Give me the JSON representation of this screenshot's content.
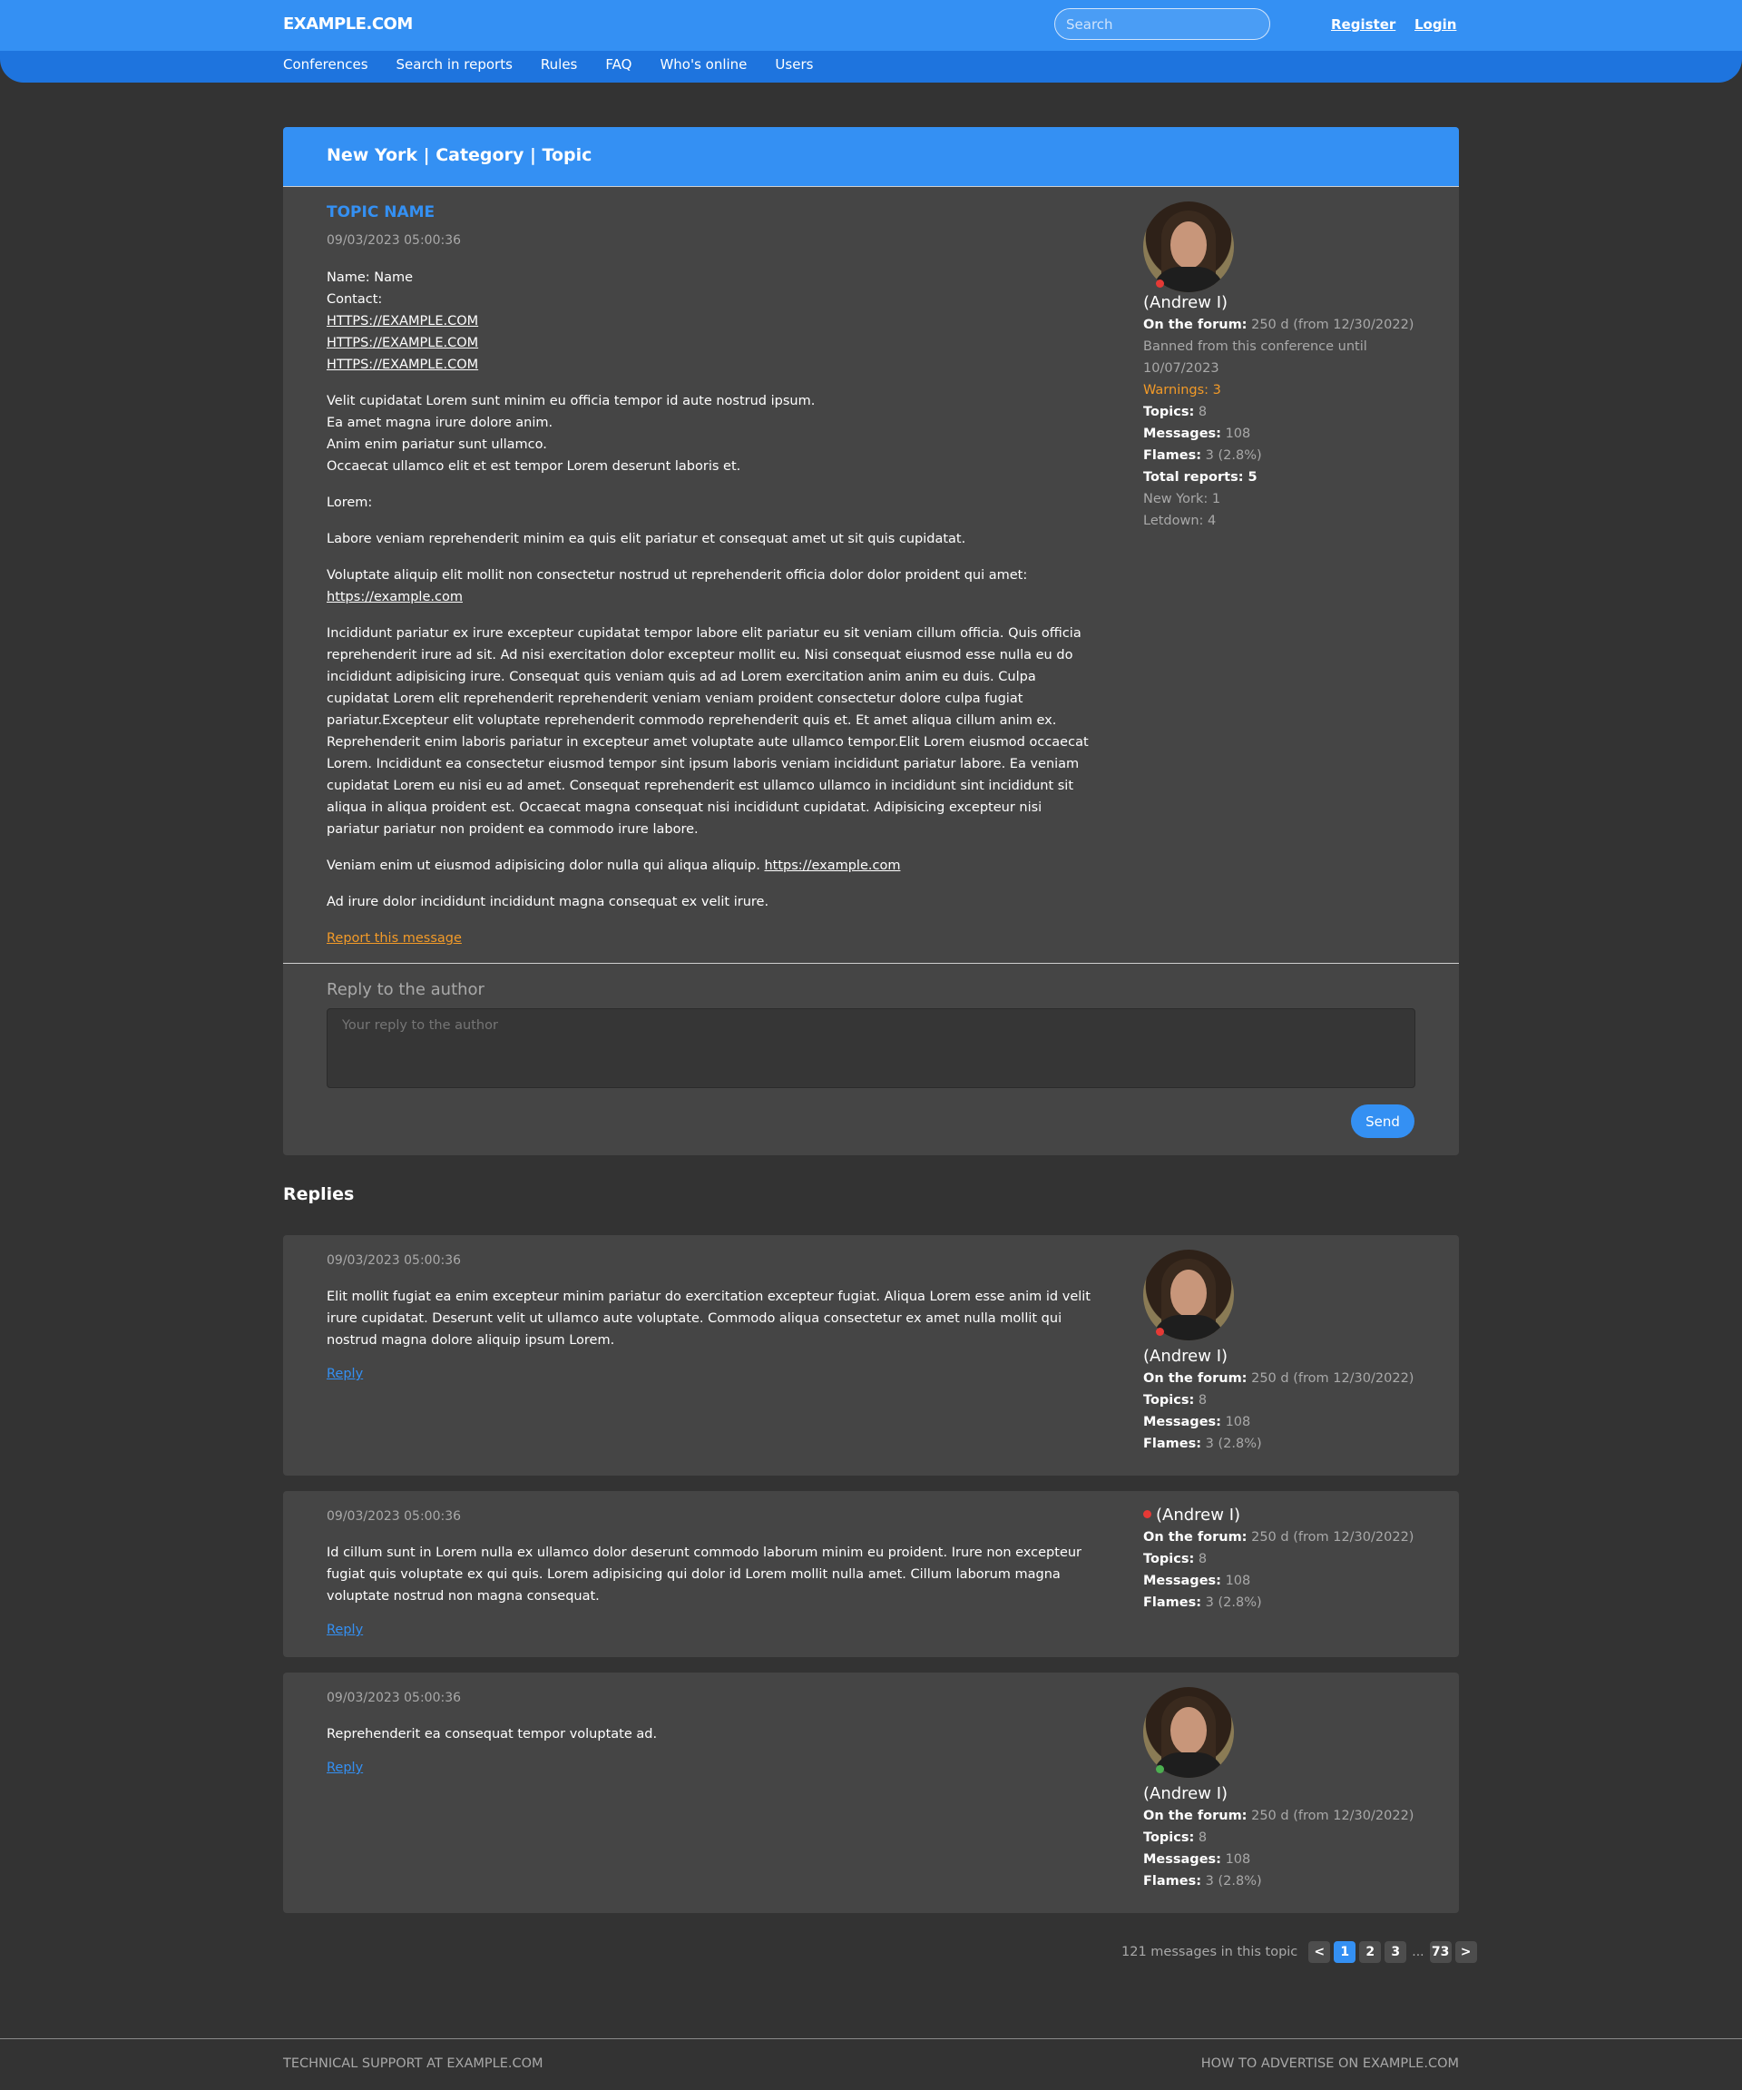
{
  "header": {
    "logo": "EXAMPLE.COM",
    "search_placeholder": "Search",
    "register": "Register",
    "login": "Login",
    "nav": [
      "Conferences",
      "Search in reports",
      "Rules",
      "FAQ",
      "Who's online",
      "Users"
    ]
  },
  "topic": {
    "breadcrumb": "New York | Category | Topic",
    "title": "TOPIC NAME",
    "date": "09/03/2023 05:00:36",
    "contact_lines": [
      "Name: Name",
      "Contact:"
    ],
    "contact_links": [
      "HTTPS://EXAMPLE.COM",
      "HTTPS://EXAMPLE.COM",
      "HTTPS://EXAMPLE.COM"
    ],
    "para1": [
      "Velit cupidatat Lorem sunt minim eu officia tempor id aute nostrud ipsum.",
      "Ea amet magna irure dolore anim.",
      "Anim enim pariatur sunt ullamco.",
      "Occaecat ullamco elit et est tempor Lorem deserunt laboris et."
    ],
    "para2": "Lorem:",
    "para3": "Labore veniam reprehenderit minim ea quis elit pariatur et consequat amet ut sit quis cupidatat.",
    "para4": "Voluptate aliquip elit mollit non consectetur nostrud ut reprehenderit officia dolor dolor proident qui amet:",
    "para4_link": "https://example.com",
    "para5": "Incididunt pariatur ex irure excepteur cupidatat tempor labore elit pariatur eu sit veniam cillum officia. Quis officia reprehenderit irure ad sit. Ad nisi exercitation dolor excepteur mollit eu. Nisi consequat eiusmod esse nulla eu do incididunt adipisicing irure. Consequat quis veniam quis ad ad Lorem exercitation anim anim eu duis. Culpa cupidatat Lorem elit reprehenderit reprehenderit veniam veniam proident consectetur dolore culpa fugiat pariatur.Excepteur elit voluptate reprehenderit commodo reprehenderit quis et. Et amet aliqua cillum anim ex. Reprehenderit enim laboris pariatur in excepteur amet voluptate aute ullamco tempor.Elit Lorem eiusmod occaecat Lorem. Incididunt ea consectetur eiusmod tempor sint ipsum laboris veniam incididunt pariatur labore. Ea veniam cupidatat Lorem eu nisi eu ad amet. Consequat reprehenderit est ullamco ullamco in incididunt sint incididunt sit aliqua in aliqua proident est. Occaecat magna consequat nisi incididunt cupidatat. Adipisicing excepteur nisi pariatur pariatur non proident ea commodo irure labore.",
    "para6": "Veniam enim ut eiusmod adipisicing dolor nulla qui aliqua aliquip.",
    "para6_link": "https://example.com",
    "para7": "Ad irure dolor incididunt incididunt magna consequat ex velit irure.",
    "report": "Report this message",
    "author": {
      "name": "(Andrew I)",
      "status_color": "#e53935",
      "on_forum_label": "On the forum:",
      "on_forum_value": "250 d (from 12/30/2022)",
      "banned": "Banned from this conference until 10/07/2023",
      "warnings": "Warnings: 3",
      "topics_label": "Topics:",
      "topics_value": "8",
      "messages_label": "Messages:",
      "messages_value": "108",
      "flames_label": "Flames:",
      "flames_value": "3 (2.8%)",
      "total_reports": "Total reports: 5",
      "report_ny": "New York: 1",
      "report_letdown": "Letdown: 4"
    }
  },
  "reply_form": {
    "title": "Reply to the author",
    "placeholder": "Your reply to the author",
    "send": "Send"
  },
  "replies_heading": "Replies",
  "replies": [
    {
      "date": "09/03/2023 05:00:36",
      "text": "Elit mollit fugiat ea enim excepteur minim pariatur do exercitation excepteur fugiat. Aliqua Lorem esse anim id velit irure cupidatat. Deserunt velit ut ullamco aute voluptate. Commodo aliqua consectetur ex amet nulla mollit qui nostrud magna dolore aliquip ipsum Lorem.",
      "reply": "Reply",
      "author": {
        "name": "(Andrew I)",
        "status_color": "#e53935",
        "on_forum_label": "On the forum:",
        "on_forum_value": "250 d (from 12/30/2022)",
        "topics_label": "Topics:",
        "topics_value": "8",
        "messages_label": "Messages:",
        "messages_value": "108",
        "flames_label": "Flames:",
        "flames_value": "3 (2.8%)"
      }
    },
    {
      "date": "09/03/2023 05:00:36",
      "text": "Id cillum sunt in Lorem nulla ex ullamco dolor deserunt commodo laborum minim eu proident. Irure non excepteur fugiat quis voluptate ex qui quis. Lorem adipisicing qui dolor id Lorem mollit nulla amet. Cillum laborum magna voluptate nostrud non magna consequat.",
      "reply": "Reply",
      "author": {
        "name": "(Andrew I)",
        "status_color": "#e53935",
        "on_forum_label": "On the forum:",
        "on_forum_value": "250 d (from 12/30/2022)",
        "topics_label": "Topics:",
        "topics_value": "8",
        "messages_label": "Messages:",
        "messages_value": "108",
        "flames_label": "Flames:",
        "flames_value": "3 (2.8%)"
      }
    },
    {
      "date": "09/03/2023 05:00:36",
      "text": "Reprehenderit ea consequat tempor voluptate ad.",
      "reply": "Reply",
      "author": {
        "name": "(Andrew I)",
        "status_color": "#4caf50",
        "on_forum_label": "On the forum:",
        "on_forum_value": "250 d (from 12/30/2022)",
        "topics_label": "Topics:",
        "topics_value": "8",
        "messages_label": "Messages:",
        "messages_value": "108",
        "flames_label": "Flames:",
        "flames_value": "3 (2.8%)"
      }
    }
  ],
  "pagination": {
    "info": "121 messages in this topic",
    "prev": "<",
    "pages": [
      "1",
      "2",
      "3"
    ],
    "ellipsis": "...",
    "last": "73",
    "next": ">"
  },
  "footer": {
    "left": "TECHNICAL SUPPORT AT EXAMPLE.COM",
    "right": "HOW TO ADVERTISE ON EXAMPLE.COM"
  }
}
